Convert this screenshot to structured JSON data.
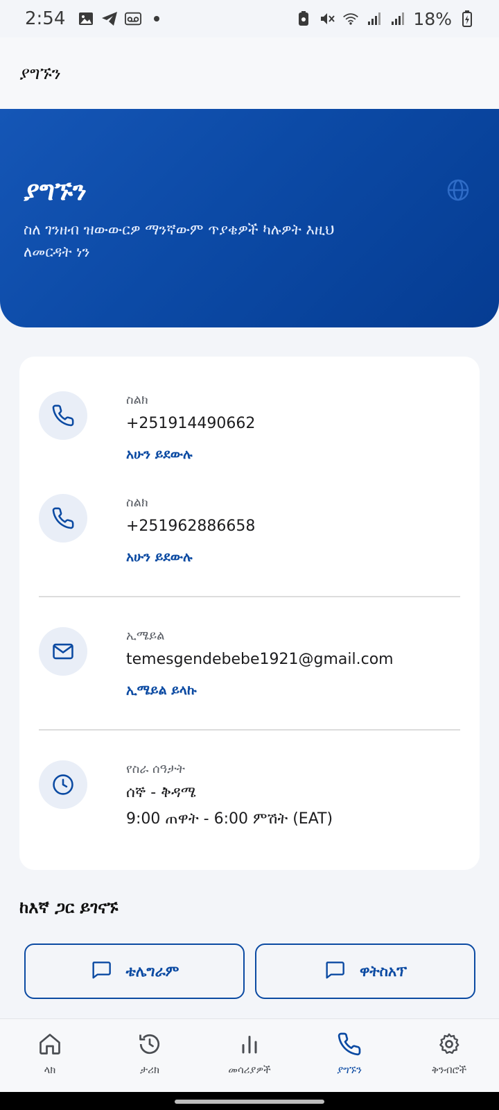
{
  "status_bar": {
    "time": "2:54",
    "battery": "18%",
    "icons_left": [
      "gallery-icon",
      "telegram-icon",
      "voicemail-icon",
      "dot"
    ],
    "icons_right": [
      "battery-saver-icon",
      "mute-icon",
      "wifi-icon",
      "signal-icon",
      "signal-icon",
      "battery-icon"
    ]
  },
  "app_bar": {
    "title": "ያግኙን"
  },
  "hero": {
    "title": "ያግኙን",
    "subtitle": "ስለ ገንዘብ ዝውውርዎ ማንኛውም ጥያቄዎች ካሉዎት እዚህ ለመርዳት ነን",
    "icon": "globe-icon"
  },
  "contacts": {
    "phone1": {
      "label": "ስልክ",
      "value": "+251914490662",
      "action": "አሁን ይደውሉ"
    },
    "phone2": {
      "label": "ስልክ",
      "value": "+251962886658",
      "action": "አሁን ይደውሉ"
    },
    "email": {
      "label": "ኢሜይል",
      "value": "temesgendebebe1921@gmail.com",
      "action": "ኢሜይል ይላኩ"
    },
    "hours": {
      "label": "የስራ ሰዓታት",
      "days": "ሰኞ - ቅዳሜ",
      "time": "9:00 ጠዋት - 6:00 ምሽት (EAT)"
    }
  },
  "connect": {
    "title": "ከእኛ ጋር ይገናኙ",
    "telegram": "ቴሌግራም",
    "whatsapp": "ዋትስአፕ"
  },
  "nav": {
    "items": [
      {
        "label": "ላክ",
        "icon": "home-icon"
      },
      {
        "label": "ታሪክ",
        "icon": "history-icon"
      },
      {
        "label": "መሳሪያዎች",
        "icon": "tools-chart-icon"
      },
      {
        "label": "ያግኙን",
        "icon": "phone-icon",
        "active": true
      },
      {
        "label": "ቅንብሮች",
        "icon": "settings-icon"
      }
    ]
  },
  "colors": {
    "primary": "#0b4aa2",
    "hero_start": "#1556b6",
    "hero_end": "#053c92",
    "background": "#f3f5f9"
  }
}
